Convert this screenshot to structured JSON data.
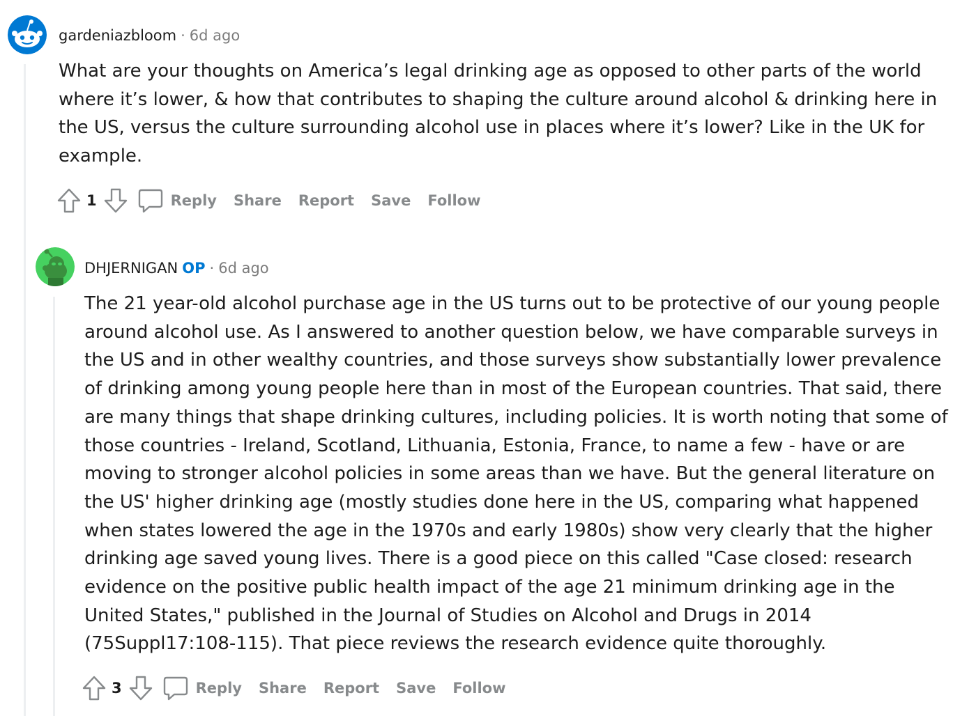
{
  "comments": [
    {
      "author": "gardeniazbloom",
      "is_op": false,
      "separator": "·",
      "time": "6d ago",
      "body": "What are your thoughts on America’s legal drinking age as opposed to other parts of the world where it’s lower, & how that contributes to shaping the culture around alcohol & drinking here in the US, versus the culture surrounding alcohol use in places where it’s lower? Like in the UK for example.",
      "score": "1",
      "actions": {
        "reply": "Reply",
        "share": "Share",
        "report": "Report",
        "save": "Save",
        "follow": "Follow"
      },
      "avatar_color": "#0079d3"
    },
    {
      "author": "DHJERNIGAN",
      "is_op": true,
      "op_label": "OP",
      "separator": "·",
      "time": "6d ago",
      "body": "The 21 year-old alcohol purchase age in the US turns out to be protective of our young people around alcohol use. As I answered to another question below, we have comparable surveys in the US and in other wealthy countries, and those surveys show substantially lower prevalence of drinking among young people here than in most of the European countries. That said, there are many things that shape drinking cultures, including policies. It is worth noting that some of those countries - Ireland, Scotland, Lithuania, Estonia, France, to name a few - have or are moving to stronger alcohol policies in some areas than we have. But the general literature on the US' higher drinking age (mostly studies done here in the US, comparing what happened when states lowered the age in the 1970s and early 1980s) show very clearly that the higher drinking age saved young lives. There is a good piece on this called \"Case closed: research evidence on the positive public health impact of the age 21 minimum drinking age in the United States,\" published in the Journal of Studies on Alcohol and Drugs in 2014 (75Suppl17:108-115). That piece reviews the research evidence quite thoroughly.",
      "score": "3",
      "actions": {
        "reply": "Reply",
        "share": "Share",
        "report": "Report",
        "save": "Save",
        "follow": "Follow"
      },
      "avatar_color": "#46d160"
    }
  ],
  "colors": {
    "op_badge": "#0079d3",
    "meta_gray": "#7c7c7c",
    "action_gray": "#878a8c",
    "thread_line": "#edeff1"
  },
  "icons": [
    "snoo-avatar-icon",
    "upvote-icon",
    "downvote-icon",
    "comment-bubble-icon"
  ]
}
